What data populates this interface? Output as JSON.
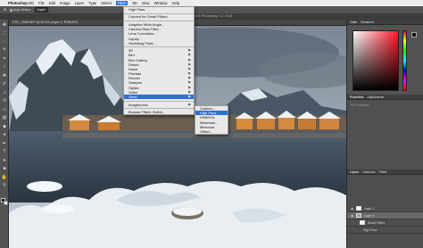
{
  "menubar": {
    "app": "Photoshop CC",
    "items": [
      "File",
      "Edit",
      "Image",
      "Layer",
      "Type",
      "Select",
      "Filter",
      "3D",
      "View",
      "Window",
      "Help"
    ],
    "active_index": 6
  },
  "options_bar": {
    "label": "Auto-Select:",
    "field": "Layer"
  },
  "window_title": "Adobe Photoshop CC 2018",
  "document_tab": "DSC_9398.NEF @ 25.3% (Layer 0, RGB/16*)",
  "panels": {
    "color_tabs": [
      "Color",
      "Swatches"
    ],
    "properties_tabs": [
      "Properties",
      "Adjustments"
    ],
    "properties_empty": "No Properties",
    "layers_tabs": [
      "Layers",
      "Channels",
      "Paths"
    ],
    "layers": [
      {
        "name": "Layer 1",
        "selected": false,
        "indent": 0,
        "thumb": "white"
      },
      {
        "name": "Layer 0",
        "selected": true,
        "indent": 0,
        "thumb": "photo"
      },
      {
        "name": "Smart Filters",
        "selected": false,
        "indent": 1,
        "thumb": "white"
      },
      {
        "name": "High Pass",
        "selected": false,
        "indent": 2,
        "thumb": "none"
      }
    ]
  },
  "filter_menu": {
    "items": [
      {
        "label": "High Pass",
        "submenu": false,
        "highlight": false
      },
      {
        "sep": true
      },
      {
        "label": "Convert for Smart Filters",
        "submenu": false,
        "highlight": false
      },
      {
        "sep": true
      },
      {
        "label": "Adaptive Wide Angle...",
        "submenu": false,
        "highlight": false
      },
      {
        "label": "Camera Raw Filter...",
        "submenu": false,
        "highlight": false
      },
      {
        "label": "Lens Correction...",
        "submenu": false,
        "highlight": false
      },
      {
        "label": "Liquify...",
        "submenu": false,
        "highlight": false
      },
      {
        "label": "Vanishing Point...",
        "submenu": false,
        "highlight": false
      },
      {
        "sep": true
      },
      {
        "label": "3D",
        "submenu": true,
        "highlight": false
      },
      {
        "label": "Blur",
        "submenu": true,
        "highlight": false
      },
      {
        "label": "Blur Gallery",
        "submenu": true,
        "highlight": false
      },
      {
        "label": "Distort",
        "submenu": true,
        "highlight": false
      },
      {
        "label": "Noise",
        "submenu": true,
        "highlight": false
      },
      {
        "label": "Pixelate",
        "submenu": true,
        "highlight": false
      },
      {
        "label": "Render",
        "submenu": true,
        "highlight": false
      },
      {
        "label": "Sharpen",
        "submenu": true,
        "highlight": false
      },
      {
        "label": "Stylize",
        "submenu": true,
        "highlight": false
      },
      {
        "label": "Video",
        "submenu": true,
        "highlight": false
      },
      {
        "label": "Other",
        "submenu": true,
        "highlight": true
      },
      {
        "sep": true
      },
      {
        "label": "Imagenomic",
        "submenu": true,
        "highlight": false
      },
      {
        "sep": true
      },
      {
        "label": "Browse Filters Online...",
        "submenu": false,
        "highlight": false
      }
    ]
  },
  "other_submenu": {
    "items": [
      {
        "label": "Custom...",
        "highlight": false
      },
      {
        "label": "High Pass...",
        "highlight": true
      },
      {
        "label": "HSB/HSL",
        "highlight": false
      },
      {
        "label": "Maximum...",
        "highlight": false
      },
      {
        "label": "Minimum...",
        "highlight": false
      },
      {
        "label": "Offset...",
        "highlight": false
      }
    ]
  }
}
